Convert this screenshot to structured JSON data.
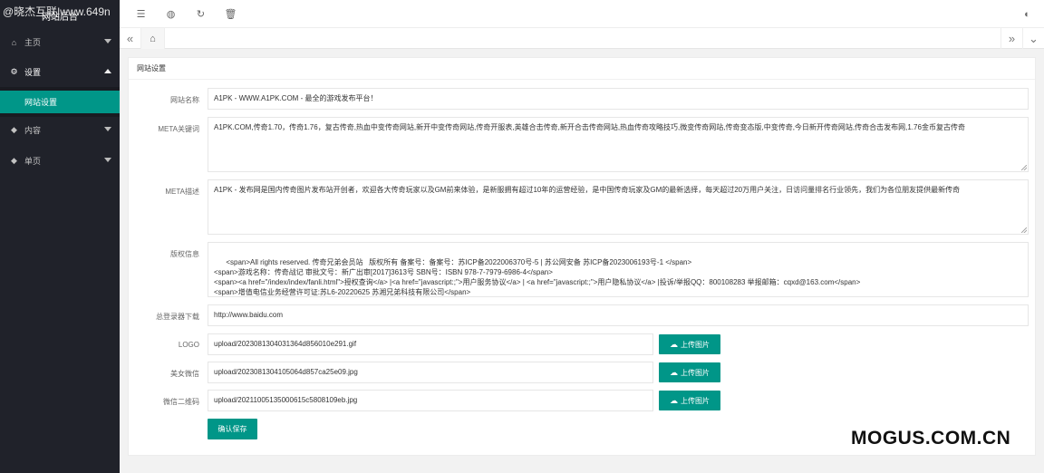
{
  "watermark": "@晓杰互联|www.649n",
  "logo_text": "网站后台",
  "sidebar": {
    "items": [
      {
        "label": "主页",
        "icon": "home-icon"
      },
      {
        "label": "设置",
        "icon": "gear-icon"
      },
      {
        "label": "内容",
        "icon": "diamond-icon"
      },
      {
        "label": "单页",
        "icon": "diamond-icon"
      }
    ],
    "active_sub": "网站设置"
  },
  "topbar": {
    "icons": [
      "menu-toggle-icon",
      "globe-icon",
      "refresh-icon",
      "trash-icon",
      "theme-icon"
    ]
  },
  "card": {
    "title": "网站设置",
    "fields": [
      {
        "label": "网站名称",
        "value": "A1PK - WWW.A1PK.COM - 最全的游戏发布平台！"
      },
      {
        "label": "META关键词",
        "value": "A1PK.COM,传奇1.70，传奇1.76，复古传奇,热血中变传奇网站,新开中变传奇网站,传奇开服表,英雄合击传奇,新开合击传奇网站,热血传奇攻略技巧,微变传奇网站,传奇变态版,中变传奇,今日新开传奇网站,传奇合击发布网,1.76金币复古传奇"
      },
      {
        "label": "META描述",
        "value": "A1PK - 发布网是国内传奇图片发布站开创者，欢迎各大传奇玩家以及GM前来体验，是新服拥有超过10年的运营经验，是中国传奇玩家及GM的最新选择，每天超过20万用户关注，日访问量排名行业领先，我们为各位朋友提供最新传奇"
      },
      {
        "label": "版权信息",
        "value": "<span>All rights reserved. 传奇兄弟会员站   版权所有 备案号：备案号：苏ICP备2022006370号-5 | 苏公网安备 苏ICP备2023006193号-1 </span>\n<span>游戏名称：传奇战记 审批文号：新广出审[2017]3613号 SBN号：ISBN 978-7-7979-6986-4</span>\n<span><a href=\"/index/index/fanli.html\">授权查询</a> |<a href=\"javascript:;\">用户服务协议</a> | <a href=\"javascript:;\">用户隐私协议</a> |投诉/举报QQ：800108283 举报邮箱：cqxd@163.com</span>\n<span>增值电信业务经营许可证:苏L6-20220625 苏湘兄弟科技有限公司</span>\n<span>抵制不良游戏，拒绝盗版游戏，注意自我保护，谨防受骗上当，适度游戏益脑，沉迷游戏伤身，合理安排时间，享受健康生活。</span>"
      },
      {
        "label": "总登录器下载",
        "value": "http://www.baidu.com"
      },
      {
        "label": "LOGO",
        "value": "upload/20230813040313­64d856010e291.gif",
        "button": "上传图片"
      },
      {
        "label": "美女微信",
        "value": "upload/2023081304105064d857ca25e09.jpg",
        "button": "上传图片"
      },
      {
        "label": "微信二维码",
        "value": "upload/20211005135000615c5808109eb.jpg",
        "button": "上传图片"
      }
    ],
    "save_label": "确认保存"
  },
  "brand_watermark": "MOGUS.COM.CN"
}
